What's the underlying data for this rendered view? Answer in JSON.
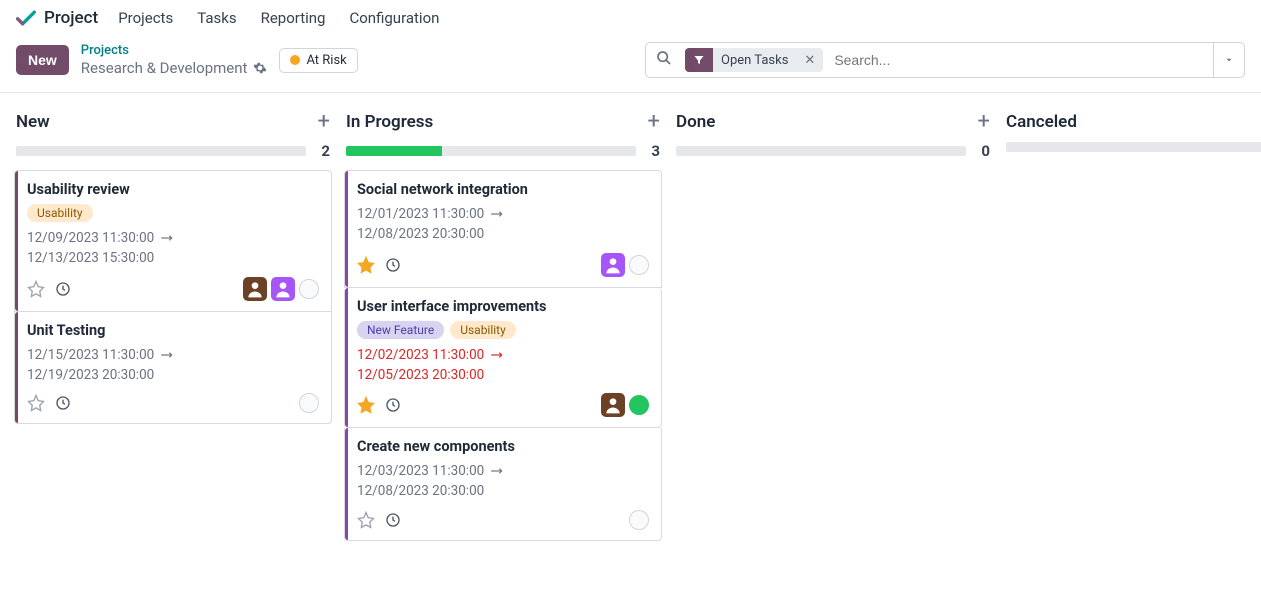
{
  "app": {
    "name": "Project"
  },
  "nav": {
    "items": [
      "Projects",
      "Tasks",
      "Reporting",
      "Configuration"
    ]
  },
  "actions": {
    "new": "New"
  },
  "breadcrumb": {
    "parent": "Projects",
    "current": "Research & Development"
  },
  "status_pill": {
    "label": "At Risk",
    "color": "#f5a623"
  },
  "search": {
    "placeholder": "Search...",
    "filter_label": "Open Tasks"
  },
  "columns": [
    {
      "title": "New",
      "count": "2",
      "progress_pct": 0,
      "cards": [
        {
          "title": "Usability review",
          "stripe": "#714B67",
          "tags": [
            {
              "label": "Usability",
              "bg": "#ffe8cc",
              "fg": "#8a5a00"
            }
          ],
          "date_start": "12/09/2023 11:30:00",
          "date_end": "12/13/2023 15:30:00",
          "overdue": false,
          "starred": false,
          "avatars": [
            {
              "bg": "#6b4226"
            },
            {
              "bg": "#a855f7"
            }
          ],
          "assignee": "empty"
        },
        {
          "title": "Unit Testing",
          "stripe": "#714B67",
          "tags": [],
          "date_start": "12/15/2023 11:30:00",
          "date_end": "12/19/2023 20:30:00",
          "overdue": false,
          "starred": false,
          "avatars": [],
          "assignee": "empty"
        }
      ]
    },
    {
      "title": "In Progress",
      "count": "3",
      "progress_pct": 33,
      "cards": [
        {
          "title": "Social network integration",
          "stripe": "#8e44ad",
          "tags": [],
          "date_start": "12/01/2023 11:30:00",
          "date_end": "12/08/2023 20:30:00",
          "overdue": false,
          "starred": true,
          "avatars": [
            {
              "bg": "#a855f7"
            }
          ],
          "assignee": "empty"
        },
        {
          "title": "User interface improvements",
          "stripe": "#8e44ad",
          "tags": [
            {
              "label": "New Feature",
              "bg": "#d8d3f0",
              "fg": "#4b3fa7"
            },
            {
              "label": "Usability",
              "bg": "#ffe8cc",
              "fg": "#8a5a00"
            }
          ],
          "date_start": "12/02/2023 11:30:00",
          "date_end": "12/05/2023 20:30:00",
          "overdue": true,
          "starred": true,
          "avatars": [
            {
              "bg": "#6b4226"
            }
          ],
          "assignee": "green"
        },
        {
          "title": "Create new components",
          "stripe": "#8e44ad",
          "tags": [],
          "date_start": "12/03/2023 11:30:00",
          "date_end": "12/08/2023 20:30:00",
          "overdue": false,
          "starred": false,
          "avatars": [],
          "assignee": "empty"
        }
      ]
    },
    {
      "title": "Done",
      "count": "0",
      "progress_pct": 0,
      "cards": []
    },
    {
      "title": "Canceled",
      "count": "",
      "progress_pct": 0,
      "cards": []
    }
  ]
}
